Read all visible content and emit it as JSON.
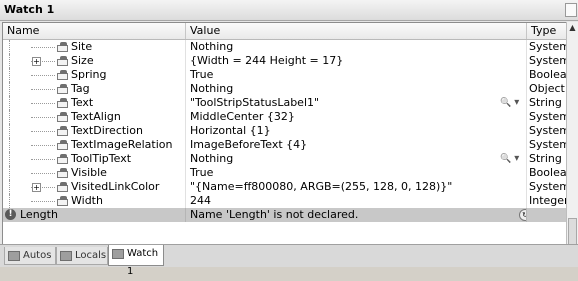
{
  "window": {
    "title": "Watch 1"
  },
  "columns": {
    "name": "Name",
    "value": "Value",
    "type": "Type"
  },
  "rows": [
    {
      "name": "Site",
      "value": "Nothing",
      "type": "System.C",
      "expandable": false
    },
    {
      "name": "Size",
      "value": "{Width = 244 Height = 17}",
      "type": "System.D",
      "expandable": true
    },
    {
      "name": "Spring",
      "value": "True",
      "type": "Boolean",
      "expandable": false
    },
    {
      "name": "Tag",
      "value": "Nothing",
      "type": "Object",
      "expandable": false
    },
    {
      "name": "Text",
      "value": "\"ToolStripStatusLabel1\"",
      "type": "String",
      "expandable": false,
      "visualizer": true
    },
    {
      "name": "TextAlign",
      "value": "MiddleCenter {32}",
      "type": "System.D",
      "expandable": false
    },
    {
      "name": "TextDirection",
      "value": "Horizontal {1}",
      "type": "System.W",
      "expandable": false
    },
    {
      "name": "TextImageRelation",
      "value": "ImageBeforeText {4}",
      "type": "System.W",
      "expandable": false
    },
    {
      "name": "ToolTipText",
      "value": "Nothing",
      "type": "String",
      "expandable": false,
      "visualizer": true
    },
    {
      "name": "Visible",
      "value": "True",
      "type": "Boolean",
      "expandable": false
    },
    {
      "name": "VisitedLinkColor",
      "value": "\"{Name=ff800080, ARGB=(255, 128, 0, 128)}\"",
      "type": "System.D",
      "expandable": true
    },
    {
      "name": "Width",
      "value": "244",
      "type": "Integer",
      "expandable": false
    }
  ],
  "error_row": {
    "name": "Length",
    "value": "Name 'Length' is not declared.",
    "type": ""
  },
  "tabs": [
    {
      "label": "Autos",
      "active": false
    },
    {
      "label": "Locals",
      "active": false
    },
    {
      "label": "Watch 1",
      "active": true
    }
  ],
  "icons": {
    "expand": "⊞",
    "magnifier": "🔍",
    "dropdown": "▾",
    "error": "!",
    "refresh": "↻",
    "scroll_up": "▲",
    "scroll_down": "▼"
  }
}
